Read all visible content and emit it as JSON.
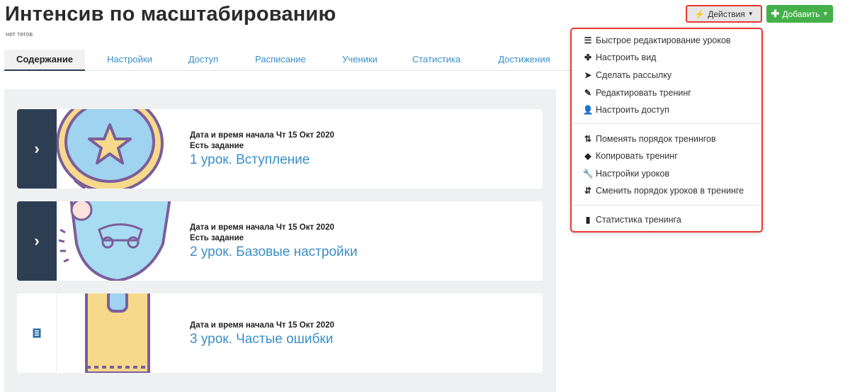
{
  "header": {
    "title": "Интенсив по масштабированию",
    "tags": "нет тегов"
  },
  "tabs": [
    {
      "label": "Содержание",
      "active": true
    },
    {
      "label": "Настройки"
    },
    {
      "label": "Доступ"
    },
    {
      "label": "Расписание"
    },
    {
      "label": "Ученики"
    },
    {
      "label": "Статистика"
    },
    {
      "label": "Достижения"
    }
  ],
  "toolbar": {
    "actions_label": "Действия",
    "actions_icon": "bolt-icon",
    "add_label": "Добавить",
    "add_icon": "plus-icon",
    "add_color": "#43b04a",
    "highlight_color": "#e53935"
  },
  "dropdown": {
    "items": [
      {
        "label": "Быстрое редактирование уроков",
        "icon": "list-icon"
      },
      {
        "label": "Настроить вид",
        "icon": "puzzle-icon"
      },
      {
        "label": "Сделать рассылку",
        "icon": "send-icon"
      },
      {
        "label": "Редактировать тренинг",
        "icon": "edit-icon"
      },
      {
        "label": "Настроить доступ",
        "icon": "user-icon"
      },
      {
        "label": "Поменять порядок тренингов",
        "icon": "sort-icon"
      },
      {
        "label": "Копировать тренинг",
        "icon": "tags-icon"
      },
      {
        "label": "Настройки уроков",
        "icon": "wrench-icon"
      },
      {
        "label": "Сменить порядок уроков в тренинге",
        "icon": "swap-icon"
      },
      {
        "label": "Статистика тренинга",
        "icon": "bar-chart-icon"
      }
    ]
  },
  "lessons": [
    {
      "start": "Дата и время начала Чт 15 Окт 2020",
      "task": "Есть задание",
      "title": "1 урок. Вступление",
      "handle_icon": "chevron-right-icon",
      "thumb": "star-badge-image"
    },
    {
      "start": "Дата и время начала Чт 15 Окт 2020",
      "task": "Есть задание",
      "title": "2 урок. Базовые настройки",
      "handle_icon": "chevron-right-icon",
      "thumb": "rocket-car-shield-image"
    },
    {
      "start": "Дата и время начала Чт 15 Окт 2020",
      "title": "3 урок. Частые ошибки",
      "handle_icon": "document-icon",
      "thumb": "ticket-image"
    }
  ]
}
